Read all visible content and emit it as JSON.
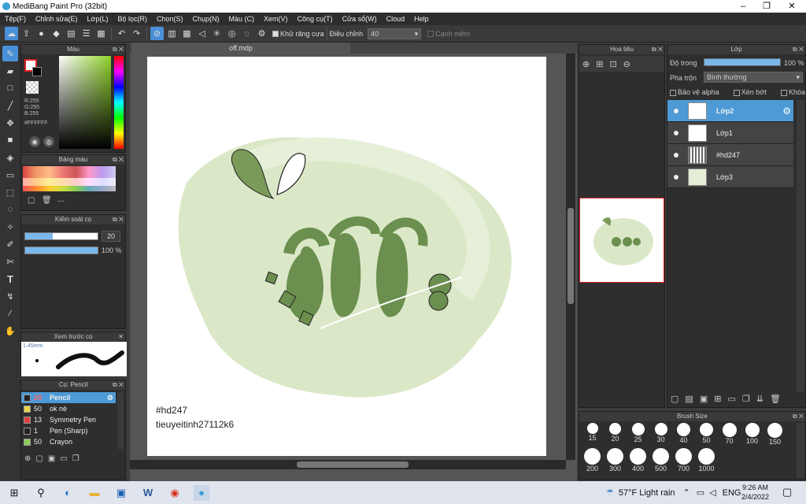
{
  "window": {
    "title": "MediBang Paint Pro (32bit)"
  },
  "menu": [
    "Tệp(F)",
    "Chỉnh sửa(E)",
    "Lớp(L)",
    "Bộ lọc(R)",
    "Chọn(S)",
    "Chụp(N)",
    "Màu (C)",
    "Xem(V)",
    "Công cụ(T)",
    "Cửa sổ(W)",
    "Cloud",
    "Help"
  ],
  "toolbar": {
    "antialias": "Khử răng cưa",
    "adjust": "Điều chỉnh",
    "adjust_value": "40",
    "edge": "Cạnh mềm"
  },
  "color_panel": {
    "title": "Màu",
    "r": "R:255",
    "g": "G:255",
    "b": "B:255",
    "hex": "#FFFFFF"
  },
  "palette_panel": {
    "title": "Bảng màu",
    "more": "---"
  },
  "brush_ctrl": {
    "title": "Kiểm soát cọ",
    "size": "20",
    "opacity": "100 %"
  },
  "preview": {
    "title": "Xem trước cọ",
    "size": "1.45mm"
  },
  "brush_list": {
    "title": "Cọ: Pencil",
    "items": [
      {
        "num": "20",
        "name": "Pencil",
        "color": "#222222"
      },
      {
        "num": "50",
        "name": "ok nè",
        "color": "#e8d44a"
      },
      {
        "num": "13",
        "name": "Symmetry Pen",
        "color": "#e04040"
      },
      {
        "num": "1",
        "name": "Pen (Sharp)",
        "color": "#222222"
      },
      {
        "num": "50",
        "name": "Crayon",
        "color": "#8bcb5a"
      }
    ]
  },
  "document": {
    "tab": "off.mdp",
    "caption1": "#hd247",
    "caption2": "tieuyeitinh27112k6"
  },
  "navigator": {
    "title": "Hoa tiêu"
  },
  "layers": {
    "title": "Lớp",
    "opacity_label": "Độ trong",
    "opacity_value": "100 %",
    "blend_label": "Pha trộn",
    "blend_value": "Bình thường",
    "protect_alpha": "Bảo vệ alpha",
    "clip": "Xén bớt",
    "lock": "Khóa",
    "items": [
      {
        "name": "Lớp2"
      },
      {
        "name": "Lớp1"
      },
      {
        "name": "#hd247"
      },
      {
        "name": "Lớp3"
      }
    ]
  },
  "brush_size": {
    "title": "Brush Size",
    "row1": [
      "15",
      "20",
      "25",
      "30",
      "40",
      "50",
      "70",
      "100",
      "150"
    ],
    "row2": [
      "200",
      "300",
      "400",
      "500",
      "700",
      "1000"
    ]
  },
  "taskbar": {
    "weather": "57°F  Light rain",
    "lang": "ENG",
    "time": "9:26 AM",
    "date": "2/4/2022"
  }
}
